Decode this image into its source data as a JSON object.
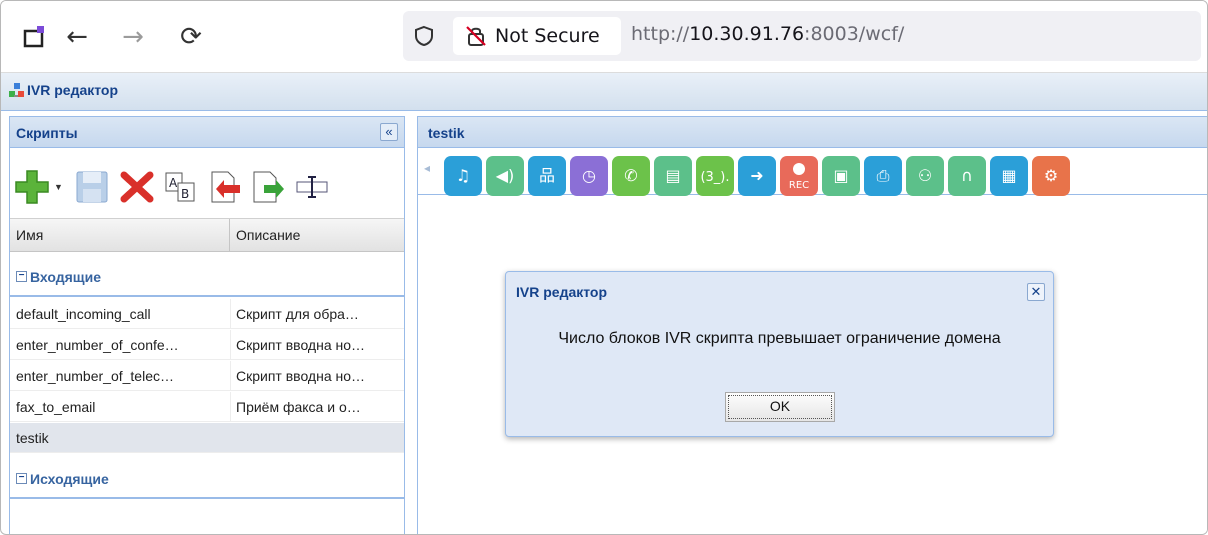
{
  "browser": {
    "security_label": "Not Secure",
    "url_prefix": "http://",
    "url_host": "10.30.91.76",
    "url_rest": ":8003/wcf/"
  },
  "app": {
    "title": "IVR редактор"
  },
  "left_panel": {
    "title": "Скрипты",
    "columns": [
      "Имя",
      "Описание"
    ],
    "groups": [
      {
        "label": "Входящие",
        "rows": [
          {
            "name": "default_incoming_call",
            "description": "Скрипт для обра…"
          },
          {
            "name": "enter_number_of_confe…",
            "description": "Скрипт вводна но…"
          },
          {
            "name": "enter_number_of_telec…",
            "description": "Скрипт вводна но…"
          },
          {
            "name": "fax_to_email",
            "description": "Приём факса и о…"
          },
          {
            "name": "testik",
            "description": ""
          }
        ]
      },
      {
        "label": "Исходящие",
        "rows": []
      }
    ]
  },
  "right_panel": {
    "title": "testik",
    "blocks": [
      {
        "icon": "music-icon",
        "color": "#2b9fd8"
      },
      {
        "icon": "speaker-icon",
        "color": "#5cc08a"
      },
      {
        "icon": "hierarchy-icon",
        "color": "#2b9fd8"
      },
      {
        "icon": "clock-icon",
        "color": "#8b6fd6"
      },
      {
        "icon": "phone-icon",
        "color": "#6cc24a"
      },
      {
        "icon": "list-icon",
        "color": "#5cc08a"
      },
      {
        "icon": "counter-icon",
        "color": "#6cc24a",
        "text": "(3_)."
      },
      {
        "icon": "forward-arrow-icon",
        "color": "#2b9fd8"
      },
      {
        "icon": "rec-icon",
        "color": "#e86a5a",
        "text": "REC"
      },
      {
        "icon": "card-icon",
        "color": "#5cc08a"
      },
      {
        "icon": "fax-icon",
        "color": "#2b9fd8"
      },
      {
        "icon": "group-icon",
        "color": "#5cc08a"
      },
      {
        "icon": "headset-icon",
        "color": "#5cc08a"
      },
      {
        "icon": "document-icon",
        "color": "#2b9fd8"
      },
      {
        "icon": "gear-icon",
        "color": "#e8734a"
      }
    ]
  },
  "dialog": {
    "title": "IVR редактор",
    "message": "Число блоков IVR скрипта превышает ограничение домена",
    "ok_label": "OK"
  }
}
